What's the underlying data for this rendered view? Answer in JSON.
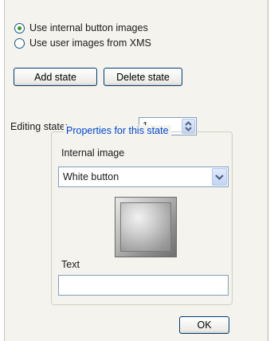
{
  "image_source": {
    "options": [
      {
        "label": "Use internal button images",
        "selected": true
      },
      {
        "label": "Use user images from XMS",
        "selected": false
      }
    ]
  },
  "buttons": {
    "add_state": "Add state",
    "delete_state": "Delete state",
    "ok": "OK"
  },
  "editing_state": {
    "label": "Editing state:",
    "value": "1"
  },
  "properties": {
    "title": "Properties for this state",
    "internal_image_label": "Internal image",
    "internal_image_value": "White button",
    "text_label": "Text",
    "text_value": ""
  },
  "colors": {
    "group_title": "#0046d5",
    "radio_dot": "#21a121",
    "button_border": "#003c74"
  },
  "icons": {
    "spin": "spin-arrows-icon",
    "dropdown": "chevron-down-icon"
  }
}
